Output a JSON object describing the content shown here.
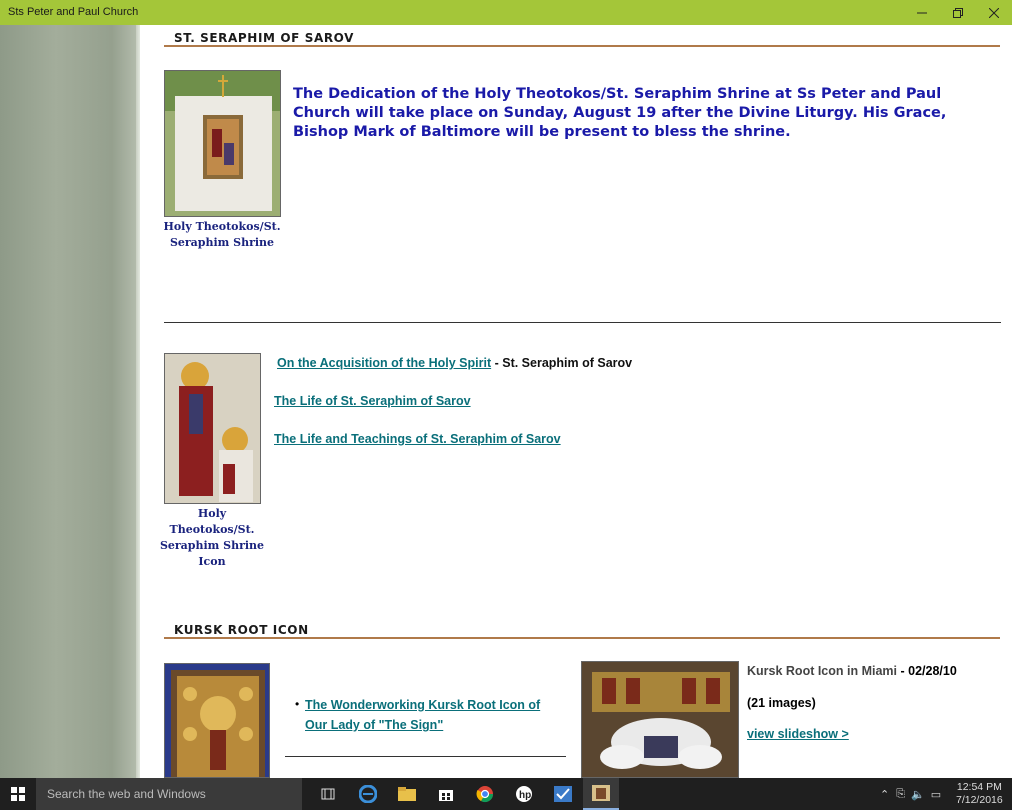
{
  "window": {
    "title": "Sts Peter and Paul Church"
  },
  "sections": {
    "seraphim": {
      "heading": "ST. SERAPHIM OF SAROV"
    },
    "kursk": {
      "heading": "KURSK ROOT ICON"
    }
  },
  "announcement": "The Dedication of the Holy Theotokos/St. Seraphim Shrine at Ss Peter and Paul Church will take place on Sunday, August 19 after the Divine Liturgy.  His Grace, Bishop Mark of Baltimore will be present to bless the shrine.",
  "captions": {
    "shrine": "Holy Theotokos/St. Seraphim Shrine",
    "shrine_icon": "Holy Theotokos/St. Seraphim Shrine Icon"
  },
  "links": {
    "acquisition": "On the Acquisition of the Holy Spirit",
    "acquisition_suffix": " - St. Seraphim of Sarov",
    "life": "The Life of St. Seraphim of Sarov",
    "teachings": "The Life and Teachings of St. Seraphim of Sarov",
    "kursk_icon": "The Wonderworking Kursk Root Icon of Our Lady of \"The Sign\""
  },
  "gallery": {
    "title": "Kursk Root Icon in Miami",
    "date": " - 02/28/10",
    "count": "(21 images)",
    "slideshow": "view slideshow >"
  },
  "taskbar": {
    "search_placeholder": "Search the web and Windows",
    "time": "12:54 PM",
    "date": "7/12/2016"
  }
}
